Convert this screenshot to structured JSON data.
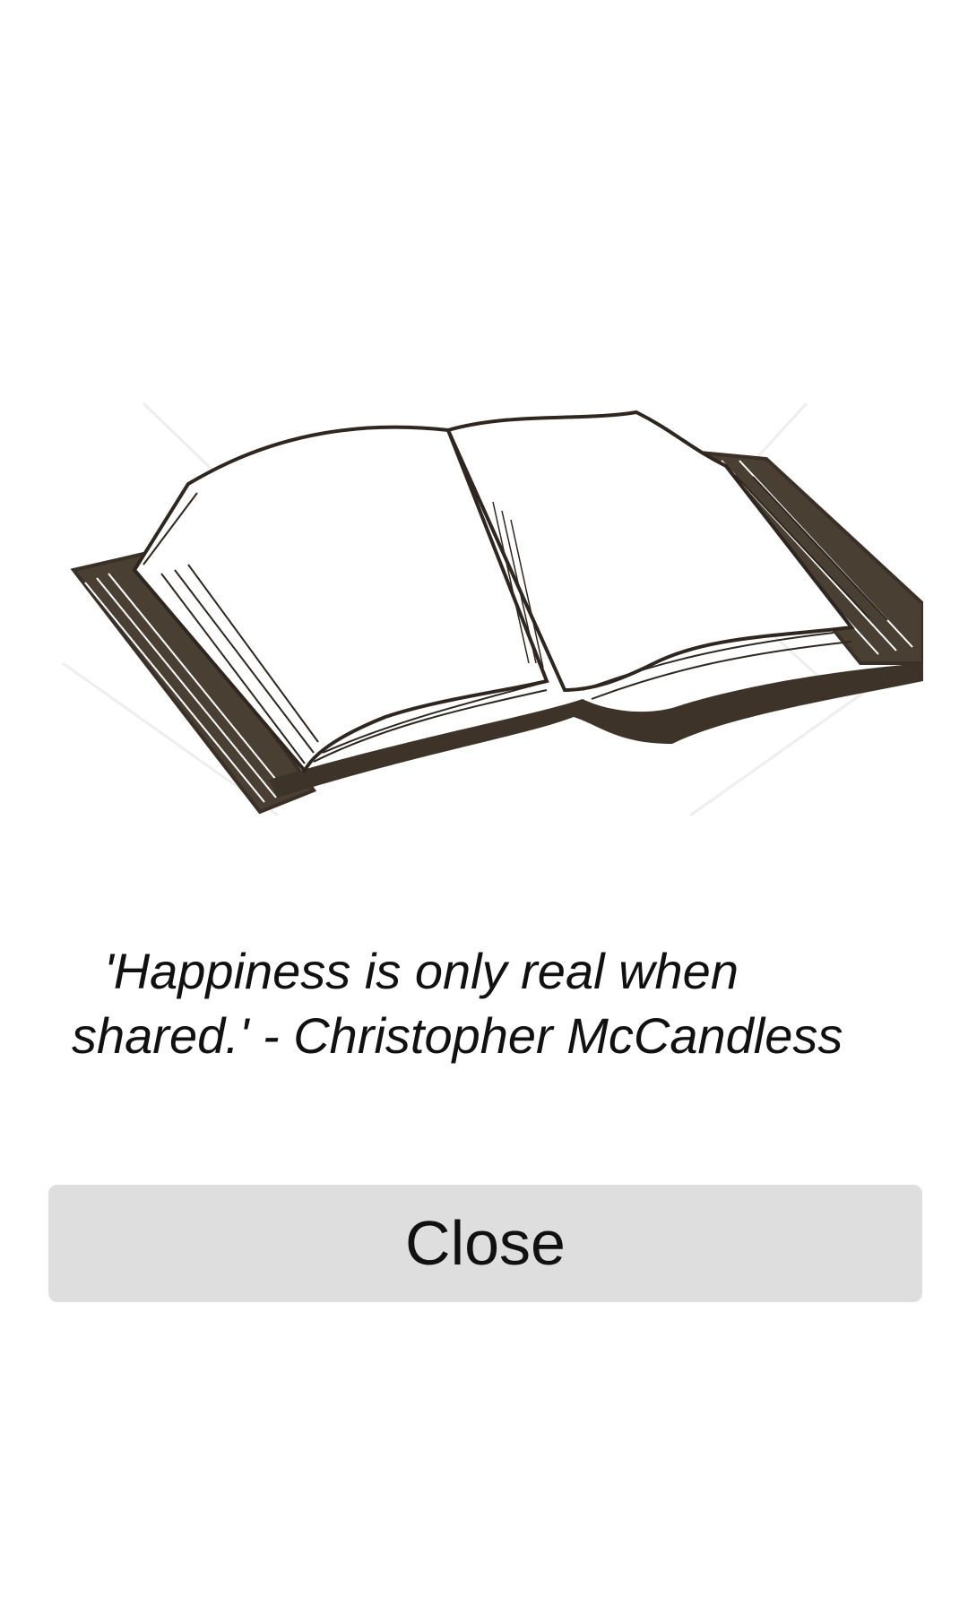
{
  "illustration": {
    "icon": "open-book-icon"
  },
  "quote": {
    "text": "'Happiness is only real when shared.' - Christopher McCandless"
  },
  "actions": {
    "close_label": "Close"
  }
}
